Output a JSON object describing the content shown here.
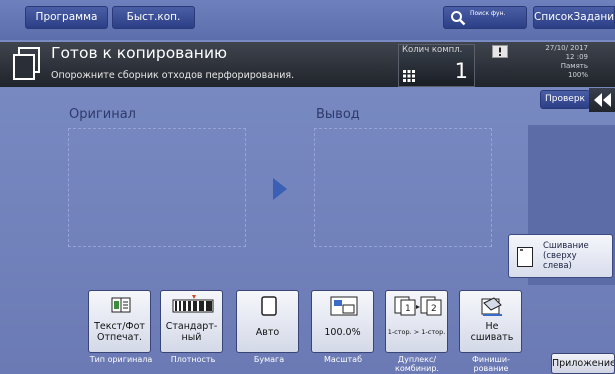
{
  "topbar": {
    "program_label": "Программа",
    "quickcopy_label": "Быст.коп.",
    "search_label": "Поиск фун.",
    "joblist_label": "СписокЗаданий"
  },
  "status": {
    "title": "Готов к копированию",
    "message": "Опорожните сборник отходов перфорирования.",
    "copies_label": "Колич компл.",
    "copies_value": "1",
    "date": "27/10/ 2017",
    "time": "12 :09",
    "memory_label": "Память",
    "memory_value": "100%"
  },
  "right": {
    "check_label": "Проверк",
    "staple_label": "Сшивание (сверху слева)"
  },
  "content": {
    "original_label": "Оригинал",
    "output_label": "Вывод"
  },
  "tools": [
    {
      "value": "Текст/Фот Отпечат.",
      "caption": "Тип оригинала",
      "icon": "document-type-icon"
    },
    {
      "value": "Стандарт-ный",
      "caption": "Плотность",
      "icon": "density-icon"
    },
    {
      "value": "Авто",
      "caption": "Бумага",
      "icon": "paper-icon"
    },
    {
      "value": "100.0%",
      "caption": "Масштаб",
      "icon": "zoom-icon"
    },
    {
      "value": "1-стор. > 1-стор.",
      "caption": "Дуплекс/ комбинир.",
      "icon": "duplex-icon"
    },
    {
      "value": "Не сшивать",
      "caption": "Финиши-рование",
      "icon": "finishing-icon"
    }
  ],
  "app_label": "Приложение",
  "colors": {
    "accent": "#2c3f86",
    "banner": "#20242b",
    "background": "#7687c0"
  }
}
